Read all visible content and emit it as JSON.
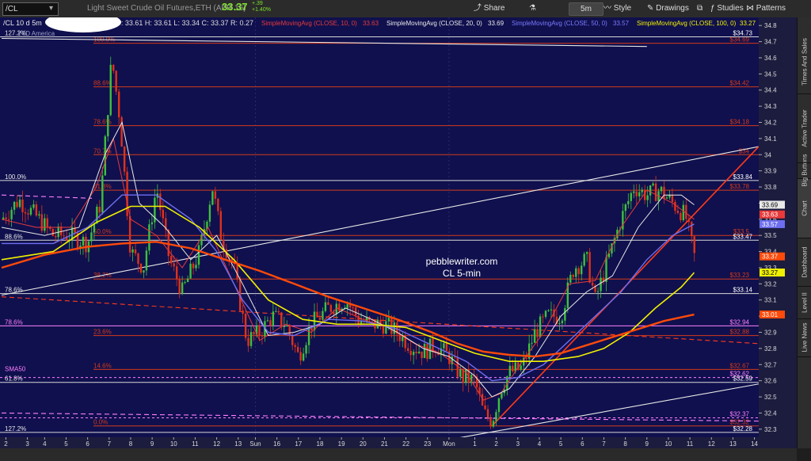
{
  "toolbar": {
    "symbol": "/CL",
    "description": "Light Sweet Crude Oil Futures,ETH (APR 16)",
    "last_price": "33.37",
    "change": "+.39",
    "change_pct": "+1.40%",
    "share_label": "Share",
    "interval": "5m",
    "style_label": "Style",
    "drawings_label": "Drawings",
    "studies_label": "Studies",
    "patterns_label": "Patterns"
  },
  "chart_header": {
    "symbol_period": "/CL 10 d 5m",
    "ohlc": "D: 2/29/16 11:20 AM   O: 33.61   H: 33.61   L: 33.34   C: 33.37   R: 0.27",
    "ytd_label": "YTD America"
  },
  "studies": [
    {
      "label": "SimpleMovingAvg (CLOSE, 10, 0)",
      "value": "33.63",
      "color": "#e83a3a"
    },
    {
      "label": "SimpleMovingAvg (CLOSE, 20, 0)",
      "value": "33.69",
      "color": "#e8e8e8"
    },
    {
      "label": "SimpleMovingAvg (CLOSE, 50, 0)",
      "value": "33.57",
      "color": "#7a7aff"
    },
    {
      "label": "SimpleMovingAvg (CLOSE, 100, 0)",
      "value": "33.27",
      "color": "#f0f000"
    }
  ],
  "sidebar_tabs": [
    "Chart",
    "Big Buttons",
    "Active Trader",
    "Times And Sales",
    "Dashboard",
    "Level II",
    "Live News"
  ],
  "colors": {
    "chart_bg": "#10104e",
    "fib": "#d23a1a",
    "up": "#3fbf3f",
    "down": "#e0321a",
    "sma10": "#e83a3a",
    "sma20": "#e8e8e8",
    "sma50": "#6e6ef0",
    "sma100": "#f0f000",
    "sma200": "#ff4a0a",
    "magenta": "#ff7fff",
    "trend_red": "#ff3a1a",
    "trend_white": "#e8e8e8"
  },
  "chart_data": {
    "type": "candlestick",
    "symbol": "/CL",
    "interval": "5m",
    "watermark": [
      "pebblewriter.com",
      "CL 5-min"
    ],
    "ylim": [
      32.25,
      34.85
    ],
    "yticks": [
      32.3,
      32.4,
      32.5,
      32.6,
      32.7,
      32.8,
      32.9,
      33,
      33.1,
      33.2,
      33.3,
      33.4,
      33.5,
      33.6,
      33.7,
      33.8,
      33.9,
      34,
      34.1,
      34.2,
      34.3,
      34.4,
      34.5,
      34.6,
      34.7,
      34.8
    ],
    "ytick_labels": [
      "32.3",
      "32.4",
      "32.5",
      "32.6",
      "32.7",
      "32.8",
      "32.9",
      "33",
      "33.1",
      "33.2",
      "33.3",
      "33.4",
      "33.5",
      "33.6",
      "33.7",
      "33.8",
      "33.9",
      "34",
      "34.1",
      "34.2",
      "34.3",
      "34.4",
      "34.5",
      "34.6",
      "34.7",
      "34.8"
    ],
    "xlim": [
      0,
      82
    ],
    "xticks": [
      {
        "x": 0.5,
        "label": "2"
      },
      {
        "x": 3,
        "label": "3"
      },
      {
        "x": 5,
        "label": "4"
      },
      {
        "x": 7.5,
        "label": "5"
      },
      {
        "x": 10,
        "label": "6"
      },
      {
        "x": 12.5,
        "label": "7"
      },
      {
        "x": 15,
        "label": "8"
      },
      {
        "x": 17.5,
        "label": "9"
      },
      {
        "x": 20,
        "label": "10"
      },
      {
        "x": 22.5,
        "label": "11"
      },
      {
        "x": 25,
        "label": "12"
      },
      {
        "x": 27.5,
        "label": "13"
      },
      {
        "x": 29.5,
        "label": "Sun"
      },
      {
        "x": 32,
        "label": "16"
      },
      {
        "x": 34.5,
        "label": "17"
      },
      {
        "x": 37,
        "label": "18"
      },
      {
        "x": 39.5,
        "label": "19"
      },
      {
        "x": 42,
        "label": "20"
      },
      {
        "x": 44.5,
        "label": "21"
      },
      {
        "x": 47,
        "label": "22"
      },
      {
        "x": 49.5,
        "label": "23"
      },
      {
        "x": 52,
        "label": "Mon"
      },
      {
        "x": 55,
        "label": "1"
      },
      {
        "x": 57.5,
        "label": "2"
      },
      {
        "x": 60,
        "label": "3"
      },
      {
        "x": 62.5,
        "label": "4"
      },
      {
        "x": 65,
        "label": "5"
      },
      {
        "x": 67.5,
        "label": "6"
      },
      {
        "x": 70,
        "label": "7"
      },
      {
        "x": 72.5,
        "label": "8"
      },
      {
        "x": 75,
        "label": "9"
      },
      {
        "x": 77.5,
        "label": "10"
      },
      {
        "x": 80,
        "label": "11"
      },
      {
        "x": 82.5,
        "label": "12"
      },
      {
        "x": 85,
        "label": "13"
      },
      {
        "x": 87.5,
        "label": "14"
      }
    ],
    "fib_levels": [
      {
        "pct": "100.0%",
        "price": 34.69
      },
      {
        "pct": "88.6%",
        "price": 34.42
      },
      {
        "pct": "78.6%",
        "price": 34.18
      },
      {
        "pct": "70.7%",
        "price": 34.0
      },
      {
        "pct": "61.8%",
        "price": 33.78
      },
      {
        "pct": "50.0%",
        "price": 33.5
      },
      {
        "pct": "38.2%",
        "price": 33.23
      },
      {
        "pct": "23.6%",
        "price": 32.88
      },
      {
        "pct": "14.6%",
        "price": 32.67
      },
      {
        "pct": "0.0%",
        "price": 32.32
      }
    ],
    "fib_price_labels": [
      "$34.69",
      "$34.42",
      "$34.18",
      "$34",
      "$33.78",
      "$33.5",
      "$33.23",
      "$32.88",
      "$32.67",
      "$32.32"
    ],
    "white_levels": [
      {
        "pct": "127.2%",
        "price": 34.73,
        "label": "$34.73"
      },
      {
        "pct": "100.0%",
        "price": 33.84,
        "label": "$33.84"
      },
      {
        "pct": "88.6%",
        "price": 33.47,
        "label": "$33.47"
      },
      {
        "pct": "78.6%",
        "price": 33.14,
        "label": "$33.14"
      },
      {
        "pct": "61.8%",
        "price": 32.59,
        "label": "$32.59"
      },
      {
        "pct": "127.2%",
        "price": 32.28,
        "label": "$32.28"
      }
    ],
    "magenta_levels": [
      {
        "pct": "78.6%",
        "price": 32.94,
        "label": "$32.94"
      },
      {
        "pct": "",
        "price": 32.62,
        "label": "$32.62"
      },
      {
        "pct": "",
        "price": 32.37,
        "label": "$32.37"
      }
    ],
    "sma50_tag": "SMA50",
    "price_tags": [
      {
        "value": "33.69",
        "color": "#e8e8e8",
        "text": "#000"
      },
      {
        "value": "33.63",
        "color": "#e83a3a",
        "text": "#fff"
      },
      {
        "value": "33.57",
        "color": "#6e6ef0",
        "text": "#fff"
      },
      {
        "value": "33.37",
        "color": "#ff4a0a",
        "text": "#fff"
      },
      {
        "value": "33.27",
        "color": "#f0f000",
        "text": "#000"
      },
      {
        "value": "33.01",
        "color": "#ff4a0a",
        "text": "#fff"
      }
    ],
    "price_anchors": [
      [
        0,
        33.6
      ],
      [
        2,
        33.72
      ],
      [
        4,
        33.62
      ],
      [
        6,
        33.5
      ],
      [
        8,
        33.5
      ],
      [
        10,
        33.45
      ],
      [
        11.5,
        33.7
      ],
      [
        12.8,
        34.6
      ],
      [
        13.8,
        34.2
      ],
      [
        15,
        33.4
      ],
      [
        16.5,
        33.3
      ],
      [
        18,
        33.8
      ],
      [
        19.5,
        33.35
      ],
      [
        21,
        33.15
      ],
      [
        23,
        33.4
      ],
      [
        24.5,
        33.8
      ],
      [
        25.5,
        33.5
      ],
      [
        27,
        33.3
      ],
      [
        28.5,
        32.85
      ],
      [
        30,
        32.9
      ],
      [
        31.5,
        33.0
      ],
      [
        33,
        32.95
      ],
      [
        34.5,
        32.75
      ],
      [
        36,
        32.95
      ],
      [
        38,
        33.05
      ],
      [
        40,
        33.1
      ],
      [
        41.5,
        32.98
      ],
      [
        43,
        32.95
      ],
      [
        44.5,
        32.95
      ],
      [
        46,
        32.9
      ],
      [
        47.5,
        32.82
      ],
      [
        49,
        32.78
      ],
      [
        50.5,
        32.82
      ],
      [
        52,
        32.75
      ],
      [
        53.5,
        32.62
      ],
      [
        55,
        32.6
      ],
      [
        56,
        32.4
      ],
      [
        57,
        32.35
      ],
      [
        58,
        32.55
      ],
      [
        59,
        32.65
      ],
      [
        60.5,
        32.68
      ],
      [
        62,
        32.9
      ],
      [
        63.5,
        33.0
      ],
      [
        65,
        33.0
      ],
      [
        66.5,
        33.3
      ],
      [
        68,
        33.35
      ],
      [
        69,
        33.1
      ],
      [
        70.5,
        33.35
      ],
      [
        72,
        33.6
      ],
      [
        73.5,
        33.8
      ],
      [
        75,
        33.75
      ],
      [
        76.5,
        33.78
      ],
      [
        78,
        33.7
      ],
      [
        79.5,
        33.62
      ],
      [
        80.5,
        33.37
      ]
    ],
    "series": [
      {
        "name": "SMA10",
        "value": "33.63",
        "values": [
          [
            0,
            33.6
          ],
          [
            4,
            33.55
          ],
          [
            8,
            33.55
          ],
          [
            11,
            33.8
          ],
          [
            13,
            34.1
          ],
          [
            15,
            33.6
          ],
          [
            18,
            33.5
          ],
          [
            21,
            33.3
          ],
          [
            24,
            33.55
          ],
          [
            27,
            33.2
          ],
          [
            30,
            32.85
          ],
          [
            33,
            32.95
          ],
          [
            36,
            32.9
          ],
          [
            39,
            33.05
          ],
          [
            42,
            32.98
          ],
          [
            45,
            32.93
          ],
          [
            48,
            32.83
          ],
          [
            51,
            32.77
          ],
          [
            54,
            32.65
          ],
          [
            56,
            32.48
          ],
          [
            58,
            32.52
          ],
          [
            60,
            32.68
          ],
          [
            63,
            32.9
          ],
          [
            66,
            33.2
          ],
          [
            69,
            33.22
          ],
          [
            72,
            33.55
          ],
          [
            75,
            33.78
          ],
          [
            78,
            33.7
          ],
          [
            80.5,
            33.6
          ]
        ]
      },
      {
        "name": "SMA20",
        "value": "33.69",
        "values": [
          [
            0,
            33.55
          ],
          [
            5,
            33.5
          ],
          [
            9,
            33.55
          ],
          [
            12,
            34.0
          ],
          [
            14,
            34.2
          ],
          [
            16,
            33.7
          ],
          [
            19,
            33.55
          ],
          [
            22,
            33.35
          ],
          [
            25,
            33.5
          ],
          [
            28,
            33.2
          ],
          [
            31,
            32.88
          ],
          [
            34,
            32.9
          ],
          [
            37,
            32.95
          ],
          [
            40,
            33.05
          ],
          [
            43,
            32.98
          ],
          [
            46,
            32.9
          ],
          [
            49,
            32.8
          ],
          [
            52,
            32.75
          ],
          [
            55,
            32.63
          ],
          [
            57,
            32.5
          ],
          [
            59,
            32.55
          ],
          [
            62,
            32.75
          ],
          [
            65,
            33.0
          ],
          [
            68,
            33.15
          ],
          [
            71,
            33.25
          ],
          [
            74,
            33.55
          ],
          [
            77,
            33.75
          ],
          [
            79,
            33.75
          ],
          [
            80.5,
            33.69
          ]
        ]
      },
      {
        "name": "SMA50",
        "value": "33.57",
        "values": [
          [
            0,
            33.45
          ],
          [
            6,
            33.45
          ],
          [
            10,
            33.55
          ],
          [
            14,
            33.75
          ],
          [
            18,
            33.75
          ],
          [
            22,
            33.6
          ],
          [
            25,
            33.4
          ],
          [
            28,
            33.1
          ],
          [
            31,
            32.9
          ],
          [
            34,
            32.88
          ],
          [
            38,
            32.98
          ],
          [
            42,
            32.97
          ],
          [
            46,
            32.92
          ],
          [
            50,
            32.82
          ],
          [
            54,
            32.72
          ],
          [
            57,
            32.6
          ],
          [
            60,
            32.62
          ],
          [
            63,
            32.7
          ],
          [
            66,
            32.85
          ],
          [
            69,
            33.0
          ],
          [
            72,
            33.15
          ],
          [
            75,
            33.35
          ],
          [
            78,
            33.5
          ],
          [
            80.5,
            33.57
          ]
        ]
      },
      {
        "name": "SMA100",
        "value": "33.27",
        "values": [
          [
            0,
            33.35
          ],
          [
            6,
            33.4
          ],
          [
            11,
            33.58
          ],
          [
            15,
            33.68
          ],
          [
            19,
            33.68
          ],
          [
            23,
            33.55
          ],
          [
            27,
            33.35
          ],
          [
            31,
            33.1
          ],
          [
            35,
            32.98
          ],
          [
            39,
            32.95
          ],
          [
            43,
            32.95
          ],
          [
            47,
            32.93
          ],
          [
            51,
            32.85
          ],
          [
            55,
            32.77
          ],
          [
            59,
            32.72
          ],
          [
            63,
            32.72
          ],
          [
            67,
            32.75
          ],
          [
            70,
            32.8
          ],
          [
            73,
            32.9
          ],
          [
            76,
            33.05
          ],
          [
            79,
            33.18
          ],
          [
            80.5,
            33.27
          ]
        ]
      },
      {
        "name": "SMA200",
        "value": "33.01",
        "values": [
          [
            0,
            33.3
          ],
          [
            5,
            33.38
          ],
          [
            10,
            33.43
          ],
          [
            14,
            33.45
          ],
          [
            18,
            33.46
          ],
          [
            22,
            33.42
          ],
          [
            26,
            33.35
          ],
          [
            30,
            33.28
          ],
          [
            34,
            33.2
          ],
          [
            38,
            33.12
          ],
          [
            42,
            33.05
          ],
          [
            46,
            32.98
          ],
          [
            50,
            32.9
          ],
          [
            53,
            32.83
          ],
          [
            56,
            32.78
          ],
          [
            59,
            32.76
          ],
          [
            62,
            32.75
          ],
          [
            65,
            32.77
          ],
          [
            68,
            32.82
          ],
          [
            71,
            32.87
          ],
          [
            74,
            32.92
          ],
          [
            77,
            32.97
          ],
          [
            80.5,
            33.01
          ]
        ]
      }
    ],
    "trendlines": [
      {
        "color": "white",
        "dash": false,
        "from": [
          0,
          33.13
        ],
        "to": [
          88,
          34.05
        ]
      },
      {
        "color": "white",
        "dash": false,
        "from": [
          52.5,
          32.24
        ],
        "to": [
          88,
          32.58
        ]
      },
      {
        "color": "red",
        "dash": false,
        "from": [
          57,
          32.32
        ],
        "to": [
          88,
          34.05
        ]
      },
      {
        "color": "red",
        "dash": true,
        "from": [
          0,
          33.12
        ],
        "to": [
          88,
          32.83
        ]
      },
      {
        "color": "magenta",
        "dash": true,
        "from": [
          0,
          33.75
        ],
        "to": [
          10.5,
          33.73
        ]
      },
      {
        "color": "magenta",
        "dash": true,
        "from": [
          0,
          32.4
        ],
        "to": [
          88,
          32.35
        ]
      },
      {
        "color": "white",
        "dash": false,
        "from": [
          0,
          34.72
        ],
        "to": [
          75,
          34.67
        ]
      }
    ]
  }
}
